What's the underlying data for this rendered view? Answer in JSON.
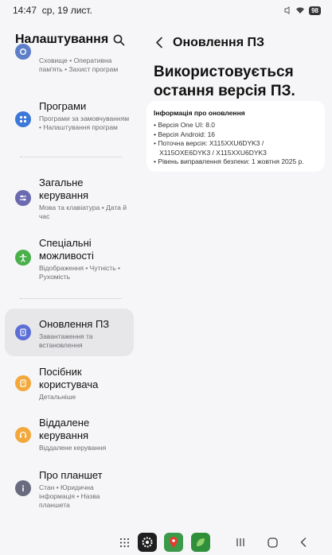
{
  "status": {
    "time": "14:47",
    "date": "ср, 19 лист.",
    "battery": "98"
  },
  "left": {
    "title": "Налаштування",
    "items": [
      {
        "title": "",
        "subtitle": "Сховище • Оперативна пам'ять • Захист програм",
        "icon": "device-care-icon",
        "color": "#5d7fc7"
      },
      {
        "title": "Програми",
        "subtitle": "Програми за замовчуванням • Налаштування програм",
        "icon": "apps-grid-icon",
        "color": "#3d78d8"
      },
      {
        "title": "Загальне керування",
        "subtitle": "Мова та клавіатура • Дата й час",
        "icon": "sliders-icon",
        "color": "#6a6ab0"
      },
      {
        "title": "Спеціальні можливості",
        "subtitle": "Відображення • Чутність • Рухомість",
        "icon": "accessibility-icon",
        "color": "#49b04a"
      },
      {
        "title": "Оновлення ПЗ",
        "subtitle": "Завантаження та встановлення",
        "icon": "software-update-icon",
        "color": "#5b6fd6"
      },
      {
        "title": "Посібник користувача",
        "subtitle": "Детальніше",
        "icon": "user-manual-icon",
        "color": "#f2a83b"
      },
      {
        "title": "Віддалене керування",
        "subtitle": "Віддалене керування",
        "icon": "headset-icon",
        "color": "#f2a83b"
      },
      {
        "title": "Про планшет",
        "subtitle": "Стан • Юридична інформація • Назва планшета",
        "icon": "info-icon",
        "color": "#6b6b80"
      }
    ]
  },
  "right": {
    "title": "Оновлення ПЗ",
    "headline": "Використовується остання версія ПЗ.",
    "info": {
      "heading": "Інформація про оновлення",
      "lines": [
        "• Версія One UI: 8.0",
        "• Версія Android: 16",
        "• Поточна версія: X115XXU6DYK3 /",
        "   X115OXE6DYK3 / X115XXU6DYK3",
        "• Рівень виправлення безпеки: 1 жовтня 2025 р."
      ]
    }
  },
  "colors": {
    "background": "#f6f6f8",
    "card": "#ffffff",
    "selected": "#e7e7ea"
  }
}
